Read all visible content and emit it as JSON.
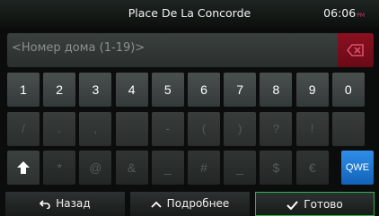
{
  "status": {
    "title": "Place De La Concorde",
    "time": "06:06",
    "ampm": "PM"
  },
  "input": {
    "value": "<Номер дома (1-19)>"
  },
  "keyboard": {
    "row1": [
      "1",
      "2",
      "3",
      "4",
      "5",
      "6",
      "7",
      "8",
      "9",
      "0"
    ],
    "row2": [
      "/",
      ".",
      ",",
      "",
      "-",
      "(",
      ")",
      "?",
      "!",
      ""
    ],
    "row3": [
      "*",
      "@",
      "&",
      "_",
      "#",
      "_",
      "$",
      "€"
    ],
    "mode_key": "QWE"
  },
  "bottom": {
    "back_label": "Назад",
    "more_label": "Подробнее",
    "done_label": "Готово"
  },
  "icons": {
    "backspace": "backspace-icon",
    "shift": "shift-arrow-icon",
    "back": "back-arrow-icon",
    "more": "chevron-up-icon",
    "done": "checkmark-icon"
  },
  "colors": {
    "accent": "#1e7fd8",
    "delete": "#8a1020",
    "confirm": "#2bb24c"
  }
}
